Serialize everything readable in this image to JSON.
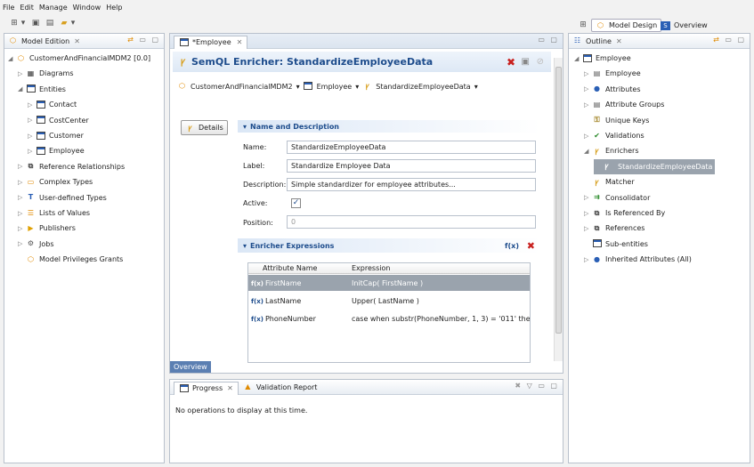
{
  "menu": [
    "File",
    "Edit",
    "Manage",
    "Window",
    "Help"
  ],
  "perspectives": {
    "model_design": "Model Design",
    "overview": "Overview"
  },
  "left": {
    "tab": "Model Edition",
    "tree": [
      {
        "label": "CustomerAndFinancialMDM2 [0.0]",
        "icon": "model-icon",
        "lvl": 0,
        "tw": "◢"
      },
      {
        "label": "Diagrams",
        "icon": "diagram-icon",
        "lvl": 1,
        "tw": "▷"
      },
      {
        "label": "Entities",
        "icon": "entity-icon",
        "lvl": 1,
        "tw": "◢"
      },
      {
        "label": "Contact",
        "icon": "entity-icon",
        "lvl": 2,
        "tw": "▷"
      },
      {
        "label": "CostCenter",
        "icon": "entity-icon",
        "lvl": 2,
        "tw": "▷"
      },
      {
        "label": "Customer",
        "icon": "entity-icon",
        "lvl": 2,
        "tw": "▷"
      },
      {
        "label": "Employee",
        "icon": "entity-icon",
        "lvl": 2,
        "tw": "▷"
      },
      {
        "label": "Reference Relationships",
        "icon": "reference-icon",
        "lvl": 1,
        "tw": "▷"
      },
      {
        "label": "Complex Types",
        "icon": "complex-type-icon",
        "lvl": 1,
        "tw": "▷"
      },
      {
        "label": "User-defined Types",
        "icon": "user-type-icon",
        "lvl": 1,
        "tw": "▷"
      },
      {
        "label": "Lists of Values",
        "icon": "list-icon",
        "lvl": 1,
        "tw": "▷"
      },
      {
        "label": "Publishers",
        "icon": "publisher-icon",
        "lvl": 1,
        "tw": "▷"
      },
      {
        "label": "Jobs",
        "icon": "jobs-icon",
        "lvl": 1,
        "tw": "▷"
      },
      {
        "label": "Model Privileges Grants",
        "icon": "privileges-icon",
        "lvl": 1,
        "tw": ""
      }
    ]
  },
  "editor": {
    "tab": "*Employee",
    "title": "SemQL Enricher: StandardizeEmployeeData",
    "breadcrumb": [
      "CustomerAndFinancialMDM2",
      "Employee",
      "StandardizeEmployeeData"
    ],
    "details_btn": "Details",
    "section1": "Name and Description",
    "labels": {
      "name": "Name:",
      "label": "Label:",
      "description": "Description:",
      "active": "Active:",
      "position": "Position:"
    },
    "values": {
      "name": "StandardizeEmployeeData",
      "label": "Standardize Employee Data",
      "description": "Simple standardizer for employee attributes...",
      "active": true,
      "position": "0"
    },
    "section2": "Enricher Expressions",
    "grid_headers": {
      "attr": "Attribute Name",
      "expr": "Expression"
    },
    "rows": [
      {
        "attr": "FirstName",
        "expr": "InitCap( FirstName )"
      },
      {
        "attr": "LastName",
        "expr": "Upper( LastName )"
      },
      {
        "attr": "PhoneNumber",
        "expr": "case  when substr(PhoneNumber, 1, 3) = '011' the"
      }
    ],
    "bottom_tab": "Overview"
  },
  "progress": {
    "tab": "Progress",
    "tab2": "Validation Report",
    "message": "No operations to display at this time."
  },
  "outline": {
    "tab": "Outline",
    "tree": [
      {
        "label": "Employee",
        "icon": "entity-icon",
        "lvl": 0,
        "tw": "◢"
      },
      {
        "label": "Employee",
        "icon": "form-icon",
        "lvl": 1,
        "tw": "▷"
      },
      {
        "label": "Attributes",
        "icon": "attributes-icon",
        "lvl": 1,
        "tw": "▷"
      },
      {
        "label": "Attribute Groups",
        "icon": "groups-icon",
        "lvl": 1,
        "tw": "▷"
      },
      {
        "label": "Unique Keys",
        "icon": "key-icon",
        "lvl": 1,
        "tw": ""
      },
      {
        "label": "Validations",
        "icon": "validation-icon",
        "lvl": 1,
        "tw": "▷"
      },
      {
        "label": "Enrichers",
        "icon": "enricher-icon",
        "lvl": 1,
        "tw": "◢"
      },
      {
        "label": "StandardizeEmployeeData",
        "icon": "enricher-icon",
        "lvl": 2,
        "tw": "",
        "sel": true
      },
      {
        "label": "Matcher",
        "icon": "matcher-icon",
        "lvl": 1,
        "tw": ""
      },
      {
        "label": "Consolidator",
        "icon": "consolidator-icon",
        "lvl": 1,
        "tw": "▷"
      },
      {
        "label": "Is Referenced By",
        "icon": "reference-icon",
        "lvl": 1,
        "tw": "▷"
      },
      {
        "label": "References",
        "icon": "reference-icon",
        "lvl": 1,
        "tw": "▷"
      },
      {
        "label": "Sub-entities",
        "icon": "entity-icon",
        "lvl": 1,
        "tw": ""
      },
      {
        "label": "Inherited Attributes (All)",
        "icon": "attributes-icon",
        "lvl": 1,
        "tw": "▷"
      }
    ]
  }
}
